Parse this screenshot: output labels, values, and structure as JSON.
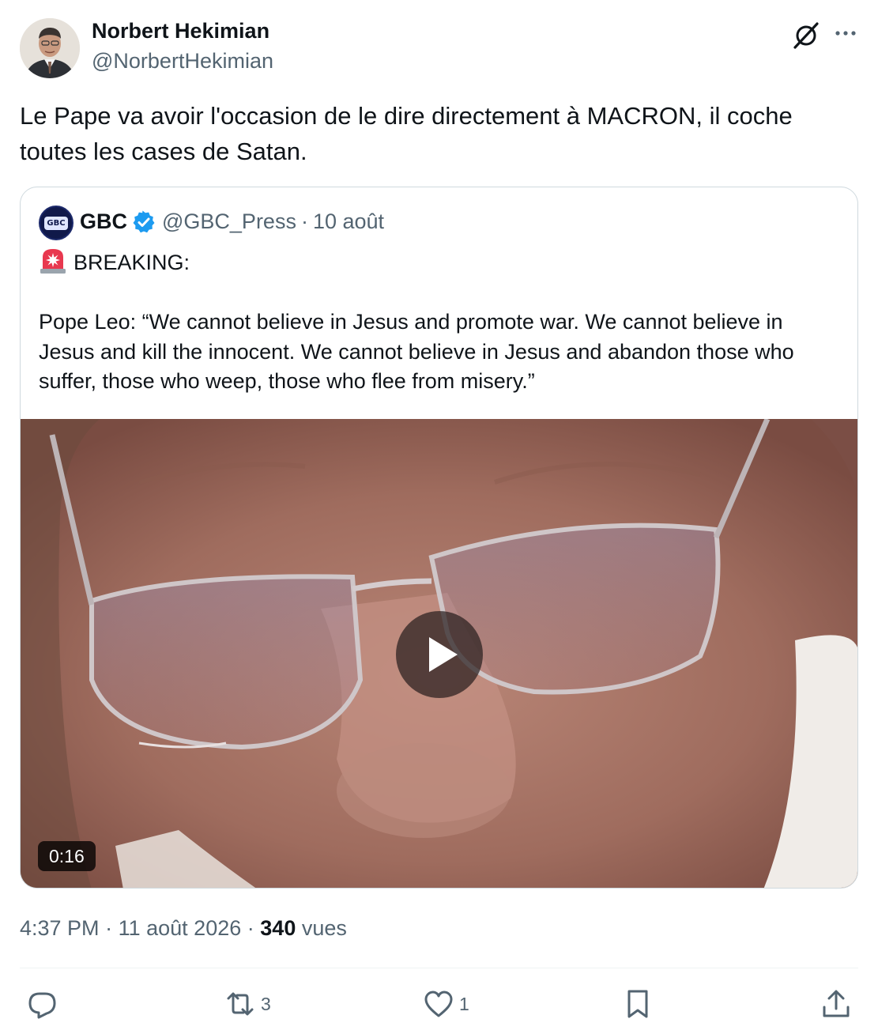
{
  "author": {
    "name": "Norbert Hekimian",
    "handle": "@NorbertHekimian"
  },
  "tweet": {
    "text": "Le Pape va avoir l'occasion de le dire directement à MACRON, il coche toutes les cases de Satan."
  },
  "quoted": {
    "avatar_text": "GBC",
    "name": "GBC",
    "handle": "@GBC_Press",
    "separator": "·",
    "date": "10 août",
    "breaking": "BREAKING:",
    "body": "Pope Leo: “We cannot believe in Jesus and promote war. We cannot believe in Jesus and kill the innocent. We cannot believe in Jesus and abandon those who suffer, those who weep, those who flee from misery.”",
    "video": {
      "duration": "0:16"
    }
  },
  "meta": {
    "time": "4:37 PM",
    "sep1": "·",
    "date": "11 août 2026",
    "sep2": "·",
    "views_count": "340",
    "views_label": "vues"
  },
  "actions": {
    "retweets": "3",
    "likes": "1"
  },
  "icons": {
    "header": [
      "grok-icon",
      "more-icon"
    ],
    "actions": [
      "reply-icon",
      "retweet-icon",
      "like-icon",
      "bookmark-icon",
      "share-icon"
    ],
    "quoted": [
      "verified-icon",
      "siren-emoji-icon",
      "play-icon"
    ]
  },
  "colors": {
    "text": "#0f1419",
    "secondary": "#536471",
    "verified": "#1d9bf0",
    "border": "#cfd9de"
  }
}
